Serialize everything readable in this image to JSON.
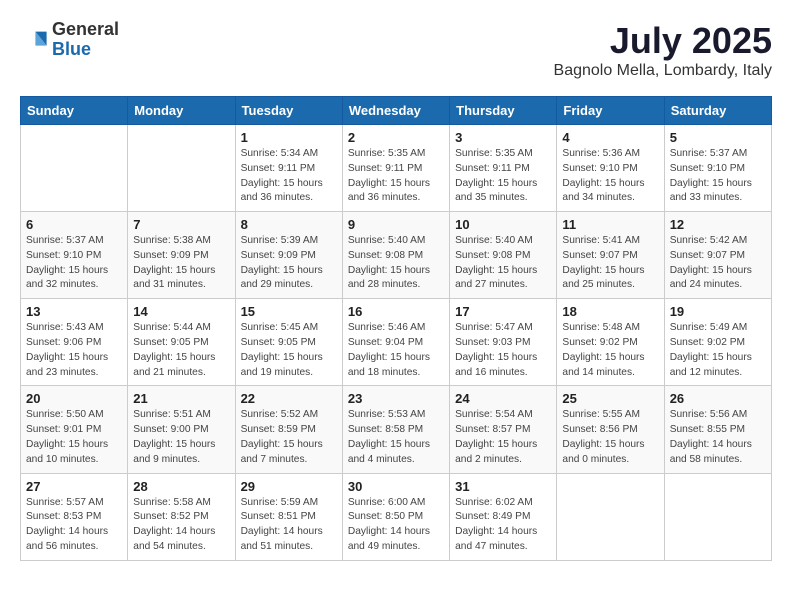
{
  "header": {
    "logo_general": "General",
    "logo_blue": "Blue",
    "month": "July 2025",
    "location": "Bagnolo Mella, Lombardy, Italy"
  },
  "days_of_week": [
    "Sunday",
    "Monday",
    "Tuesday",
    "Wednesday",
    "Thursday",
    "Friday",
    "Saturday"
  ],
  "weeks": [
    [
      {
        "day": "",
        "info": ""
      },
      {
        "day": "",
        "info": ""
      },
      {
        "day": "1",
        "info": "Sunrise: 5:34 AM\nSunset: 9:11 PM\nDaylight: 15 hours and 36 minutes."
      },
      {
        "day": "2",
        "info": "Sunrise: 5:35 AM\nSunset: 9:11 PM\nDaylight: 15 hours and 36 minutes."
      },
      {
        "day": "3",
        "info": "Sunrise: 5:35 AM\nSunset: 9:11 PM\nDaylight: 15 hours and 35 minutes."
      },
      {
        "day": "4",
        "info": "Sunrise: 5:36 AM\nSunset: 9:10 PM\nDaylight: 15 hours and 34 minutes."
      },
      {
        "day": "5",
        "info": "Sunrise: 5:37 AM\nSunset: 9:10 PM\nDaylight: 15 hours and 33 minutes."
      }
    ],
    [
      {
        "day": "6",
        "info": "Sunrise: 5:37 AM\nSunset: 9:10 PM\nDaylight: 15 hours and 32 minutes."
      },
      {
        "day": "7",
        "info": "Sunrise: 5:38 AM\nSunset: 9:09 PM\nDaylight: 15 hours and 31 minutes."
      },
      {
        "day": "8",
        "info": "Sunrise: 5:39 AM\nSunset: 9:09 PM\nDaylight: 15 hours and 29 minutes."
      },
      {
        "day": "9",
        "info": "Sunrise: 5:40 AM\nSunset: 9:08 PM\nDaylight: 15 hours and 28 minutes."
      },
      {
        "day": "10",
        "info": "Sunrise: 5:40 AM\nSunset: 9:08 PM\nDaylight: 15 hours and 27 minutes."
      },
      {
        "day": "11",
        "info": "Sunrise: 5:41 AM\nSunset: 9:07 PM\nDaylight: 15 hours and 25 minutes."
      },
      {
        "day": "12",
        "info": "Sunrise: 5:42 AM\nSunset: 9:07 PM\nDaylight: 15 hours and 24 minutes."
      }
    ],
    [
      {
        "day": "13",
        "info": "Sunrise: 5:43 AM\nSunset: 9:06 PM\nDaylight: 15 hours and 23 minutes."
      },
      {
        "day": "14",
        "info": "Sunrise: 5:44 AM\nSunset: 9:05 PM\nDaylight: 15 hours and 21 minutes."
      },
      {
        "day": "15",
        "info": "Sunrise: 5:45 AM\nSunset: 9:05 PM\nDaylight: 15 hours and 19 minutes."
      },
      {
        "day": "16",
        "info": "Sunrise: 5:46 AM\nSunset: 9:04 PM\nDaylight: 15 hours and 18 minutes."
      },
      {
        "day": "17",
        "info": "Sunrise: 5:47 AM\nSunset: 9:03 PM\nDaylight: 15 hours and 16 minutes."
      },
      {
        "day": "18",
        "info": "Sunrise: 5:48 AM\nSunset: 9:02 PM\nDaylight: 15 hours and 14 minutes."
      },
      {
        "day": "19",
        "info": "Sunrise: 5:49 AM\nSunset: 9:02 PM\nDaylight: 15 hours and 12 minutes."
      }
    ],
    [
      {
        "day": "20",
        "info": "Sunrise: 5:50 AM\nSunset: 9:01 PM\nDaylight: 15 hours and 10 minutes."
      },
      {
        "day": "21",
        "info": "Sunrise: 5:51 AM\nSunset: 9:00 PM\nDaylight: 15 hours and 9 minutes."
      },
      {
        "day": "22",
        "info": "Sunrise: 5:52 AM\nSunset: 8:59 PM\nDaylight: 15 hours and 7 minutes."
      },
      {
        "day": "23",
        "info": "Sunrise: 5:53 AM\nSunset: 8:58 PM\nDaylight: 15 hours and 4 minutes."
      },
      {
        "day": "24",
        "info": "Sunrise: 5:54 AM\nSunset: 8:57 PM\nDaylight: 15 hours and 2 minutes."
      },
      {
        "day": "25",
        "info": "Sunrise: 5:55 AM\nSunset: 8:56 PM\nDaylight: 15 hours and 0 minutes."
      },
      {
        "day": "26",
        "info": "Sunrise: 5:56 AM\nSunset: 8:55 PM\nDaylight: 14 hours and 58 minutes."
      }
    ],
    [
      {
        "day": "27",
        "info": "Sunrise: 5:57 AM\nSunset: 8:53 PM\nDaylight: 14 hours and 56 minutes."
      },
      {
        "day": "28",
        "info": "Sunrise: 5:58 AM\nSunset: 8:52 PM\nDaylight: 14 hours and 54 minutes."
      },
      {
        "day": "29",
        "info": "Sunrise: 5:59 AM\nSunset: 8:51 PM\nDaylight: 14 hours and 51 minutes."
      },
      {
        "day": "30",
        "info": "Sunrise: 6:00 AM\nSunset: 8:50 PM\nDaylight: 14 hours and 49 minutes."
      },
      {
        "day": "31",
        "info": "Sunrise: 6:02 AM\nSunset: 8:49 PM\nDaylight: 14 hours and 47 minutes."
      },
      {
        "day": "",
        "info": ""
      },
      {
        "day": "",
        "info": ""
      }
    ]
  ]
}
